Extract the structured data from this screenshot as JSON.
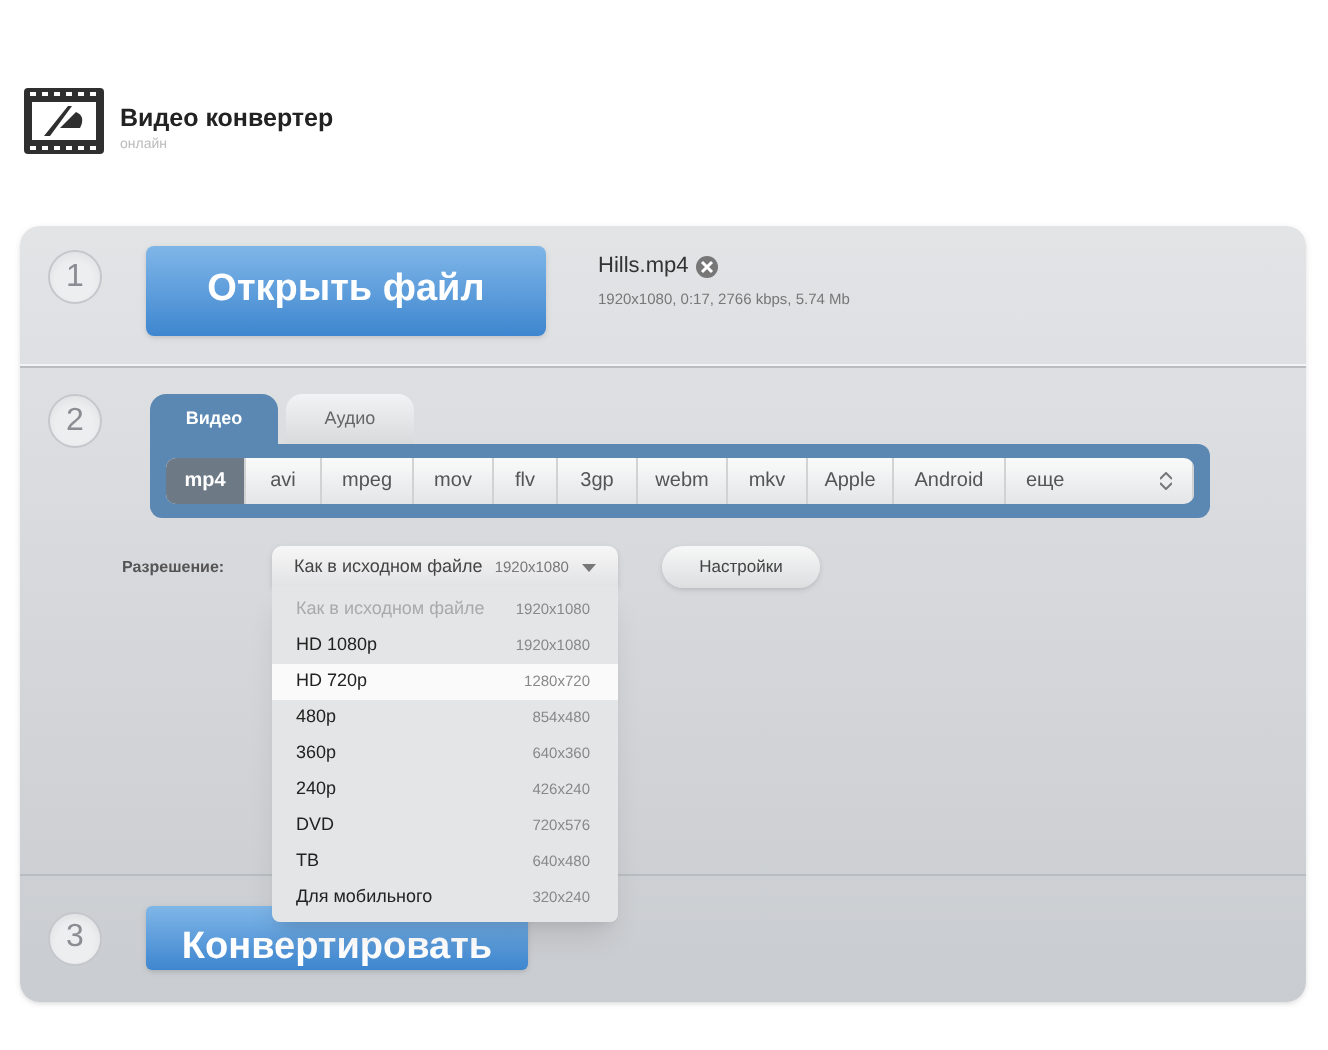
{
  "header": {
    "title": "Видео конвертер",
    "subtitle": "онлайн"
  },
  "step1": {
    "number": "1",
    "button": "Открыть файл",
    "file": {
      "name": "Hills.mp4",
      "info": "1920x1080, 0:17, 2766 kbps, 5.74 Mb"
    }
  },
  "step2": {
    "number": "2",
    "tabs": [
      {
        "label": "Видео",
        "selected": true
      },
      {
        "label": "Аудио",
        "selected": false
      }
    ],
    "formats": [
      {
        "label": "mp4",
        "selected": true
      },
      {
        "label": "avi",
        "selected": false
      },
      {
        "label": "mpeg",
        "selected": false
      },
      {
        "label": "mov",
        "selected": false
      },
      {
        "label": "flv",
        "selected": false
      },
      {
        "label": "3gp",
        "selected": false
      },
      {
        "label": "webm",
        "selected": false
      },
      {
        "label": "mkv",
        "selected": false
      },
      {
        "label": "Apple",
        "selected": false
      },
      {
        "label": "Android",
        "selected": false
      },
      {
        "label": "еще",
        "selected": false
      }
    ],
    "resolution_label": "Разрешение:",
    "resolution": {
      "value": "Как в исходном файле",
      "size": "1920x1080",
      "expanded": true
    },
    "settings_button": "Настройки",
    "options": [
      {
        "label": "Как в исходном файле",
        "size": "1920x1080",
        "disabled": true,
        "selected": false
      },
      {
        "label": "HD 1080p",
        "size": "1920x1080",
        "disabled": false,
        "selected": false
      },
      {
        "label": "HD 720p",
        "size": "1280x720",
        "disabled": false,
        "selected": true
      },
      {
        "label": "480p",
        "size": "854x480",
        "disabled": false,
        "selected": false
      },
      {
        "label": "360p",
        "size": "640x360",
        "disabled": false,
        "selected": false
      },
      {
        "label": "240p",
        "size": "426x240",
        "disabled": false,
        "selected": false
      },
      {
        "label": "DVD",
        "size": "720x576",
        "disabled": false,
        "selected": false
      },
      {
        "label": "ТВ",
        "size": "640x480",
        "disabled": false,
        "selected": false
      },
      {
        "label": "Для мобильного",
        "size": "320x240",
        "disabled": false,
        "selected": false
      }
    ]
  },
  "step3": {
    "number": "3",
    "button": "Конвертировать"
  }
}
